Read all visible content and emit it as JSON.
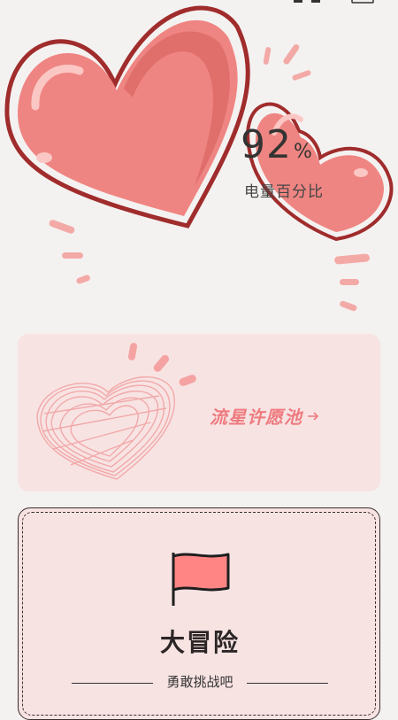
{
  "status_bar": {
    "time": "",
    "network_speed": ""
  },
  "battery": {
    "value": "92",
    "unit": "%",
    "label": "电量百分比"
  },
  "wish_card": {
    "title": "流星许愿池",
    "arrow": "→"
  },
  "adventure_card": {
    "title": "大冒险",
    "subtitle": "勇敢挑战吧"
  },
  "colors": {
    "background": "#f4f2f1",
    "card_bg": "#f8e3e3",
    "heart_fill": "#ef8582",
    "heart_outline": "#a02c2c",
    "accent_text": "#ee7b7f",
    "flag": "#ff8585"
  },
  "icons": {
    "big_heart": "heart-icon",
    "small_heart": "heart-icon",
    "scribble_heart": "scribble-heart-icon",
    "flag": "flag-icon",
    "arrow": "arrow-right-icon"
  }
}
